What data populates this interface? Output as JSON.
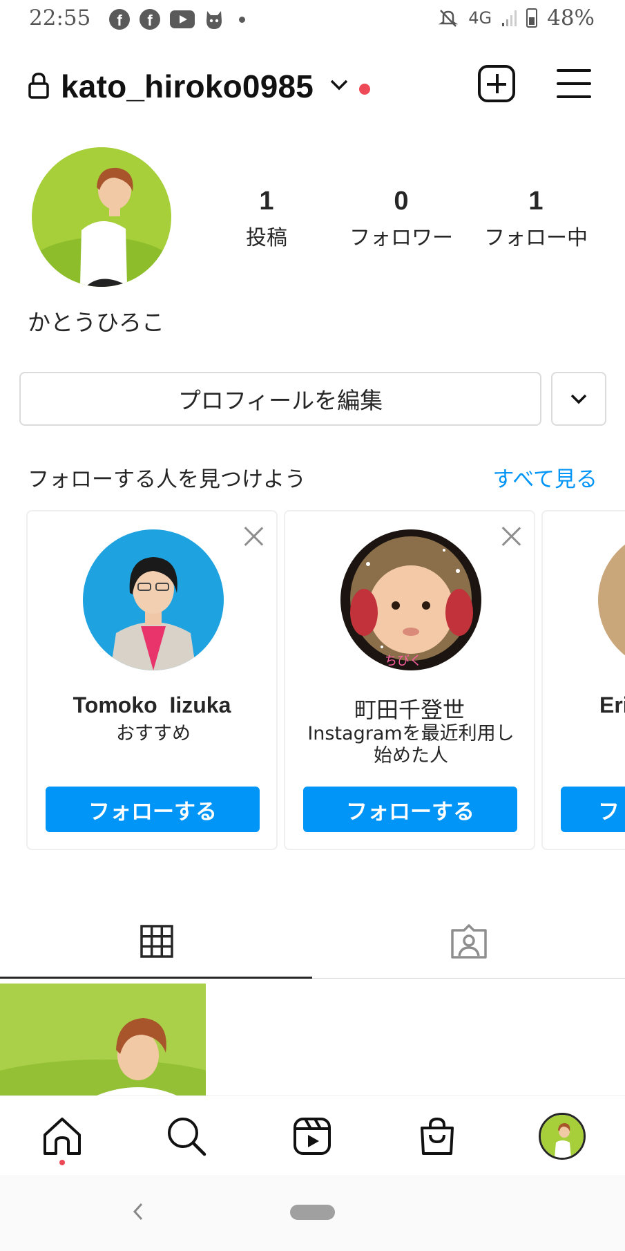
{
  "status_bar": {
    "time": "22:55",
    "network": "4G",
    "battery": "48%",
    "icons": [
      "facebook-icon",
      "facebook-icon",
      "youtube-icon",
      "cat-app-icon",
      "dot-icon",
      "mute-icon",
      "signal-icon",
      "battery-icon"
    ]
  },
  "header": {
    "username": "kato_hiroko0985",
    "has_notification_dot": true
  },
  "profile": {
    "display_name": "かとうひろこ",
    "stats": [
      {
        "value": "1",
        "label": "投稿"
      },
      {
        "value": "0",
        "label": "フォロワー"
      },
      {
        "value": "1",
        "label": "フォロー中"
      }
    ],
    "edit_button_label": "プロフィールを編集"
  },
  "suggestions": {
    "title": "フォローする人を見つけよう",
    "see_all_label": "すべて見る",
    "cards": [
      {
        "name": "Tomoko  Iizuka",
        "subtitle": "おすすめ",
        "follow_label": "フォローする"
      },
      {
        "name": "町田千登世",
        "subtitle": "Instagramを最近利用し始めた人",
        "follow_label": "フォローする"
      },
      {
        "name": "Eri",
        "subtitle": "",
        "follow_label": "フ"
      }
    ]
  },
  "tabs": [
    {
      "name": "posts-grid",
      "icon": "grid-icon",
      "active": true
    },
    {
      "name": "tagged",
      "icon": "tagged-person-icon",
      "active": false
    }
  ],
  "bottom_nav": [
    {
      "name": "home",
      "icon": "home-icon"
    },
    {
      "name": "search",
      "icon": "search-icon"
    },
    {
      "name": "reels",
      "icon": "reels-icon"
    },
    {
      "name": "shop",
      "icon": "shopping-bag-icon"
    },
    {
      "name": "profile",
      "icon": "profile-avatar"
    }
  ],
  "colors": {
    "accent": "#0095f6",
    "notification": "#ed4956",
    "text": "#262626",
    "border": "#dbdbdb"
  }
}
